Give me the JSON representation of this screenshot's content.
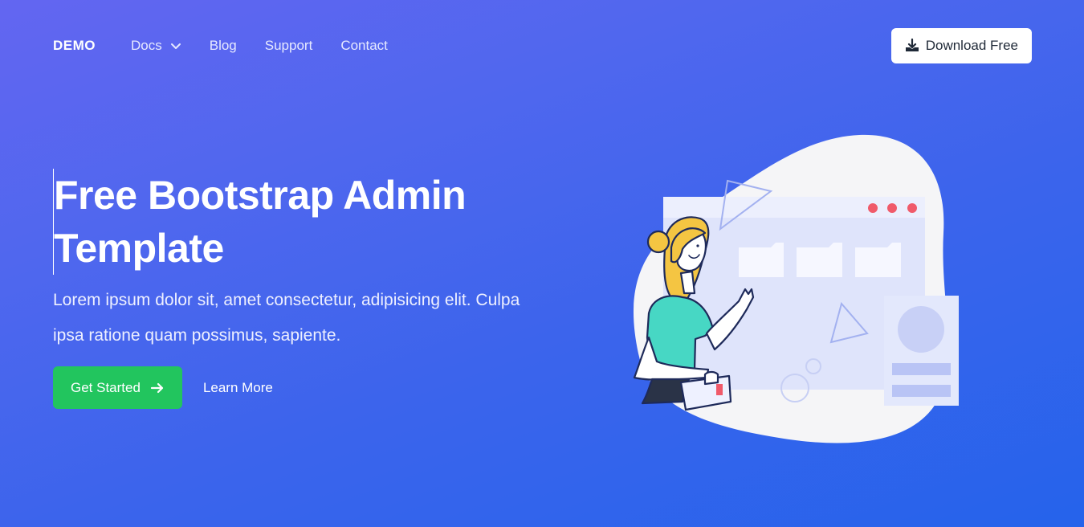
{
  "nav": {
    "brand": "DEMO",
    "links": [
      {
        "label": "Docs",
        "has_dropdown": true
      },
      {
        "label": "Blog"
      },
      {
        "label": "Support"
      },
      {
        "label": "Contact"
      }
    ],
    "download_label": "Download Free",
    "download_icon": "download-icon"
  },
  "hero": {
    "title_line1": "Free Bootstrap Admin",
    "title_line2": "Template",
    "subtitle": "Lorem ipsum dolor sit, amet consectetur, adipisicing elit. Culpa ipsa ratione quam possimus, sapiente.",
    "primary_label": "Get Started",
    "primary_icon": "arrow-right-icon",
    "secondary_label": "Learn More"
  },
  "colors": {
    "bg_start": "#6366f1",
    "bg_end": "#2563eb",
    "primary_button": "#22c55e",
    "dot_red": "#f05a6a"
  }
}
